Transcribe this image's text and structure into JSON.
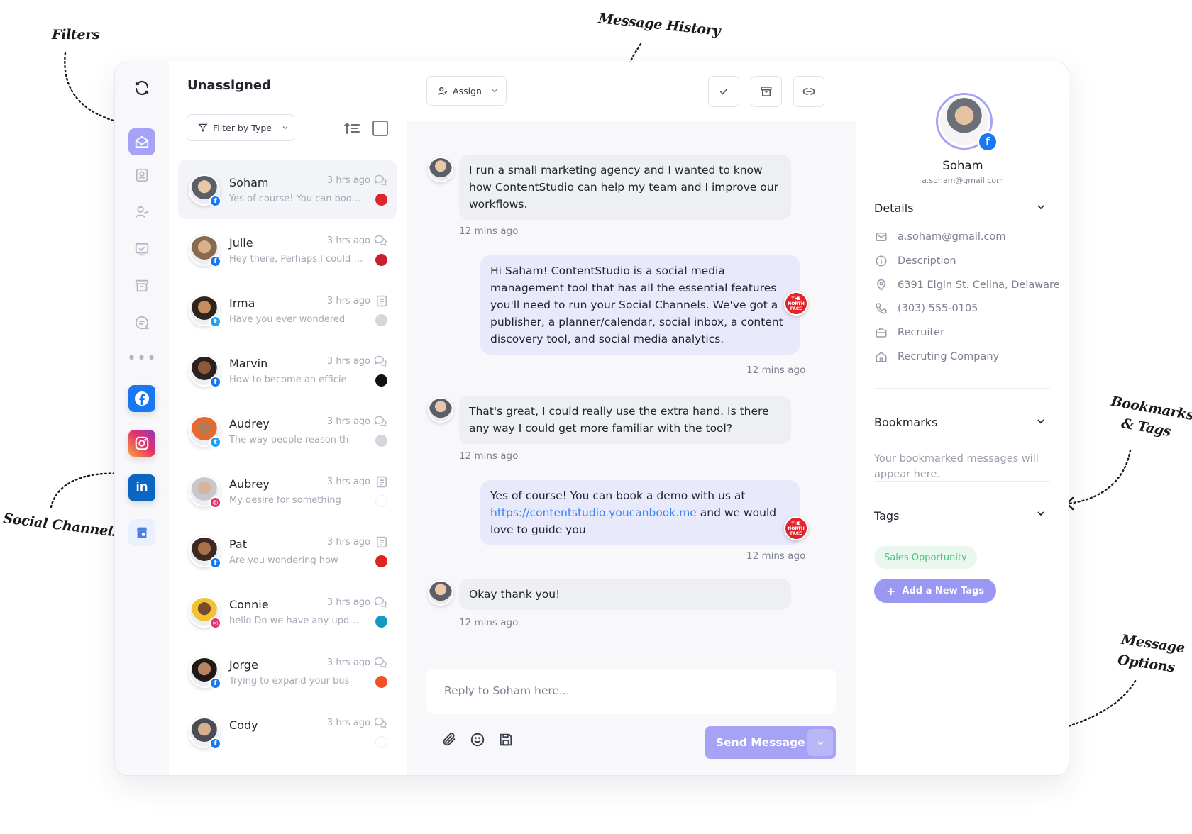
{
  "annotations": {
    "filters": "Filters",
    "message_history": "Message History",
    "social_channels": "Social Channels",
    "bookmarks_tags_line1": "Bookmarks",
    "bookmarks_tags_line2": "& Tags",
    "message_options_line1": "Message",
    "message_options_line2": "Options"
  },
  "list": {
    "title": "Unassigned",
    "filter_label": "Filter by Type",
    "conversations": [
      {
        "name": "Soham",
        "time": "3 hrs ago",
        "preview": "Yes of course! You can book...",
        "channel": "facebook",
        "type_icon": "chat-icon",
        "brand_color": "#e0242c"
      },
      {
        "name": "Julie",
        "time": "3 hrs ago",
        "preview": "Hey there, Perhaps I could i...",
        "channel": "facebook",
        "type_icon": "chat-icon",
        "brand_color": "#c8202f"
      },
      {
        "name": "Irma",
        "time": "3 hrs ago",
        "preview": "Have you ever wondered",
        "channel": "twitter",
        "type_icon": "post-icon",
        "brand_color": "#d5d6db"
      },
      {
        "name": "Marvin",
        "time": "3 hrs ago",
        "preview": "How to become an efficie",
        "channel": "facebook",
        "type_icon": "chat-icon",
        "brand_color": "#111111"
      },
      {
        "name": "Audrey",
        "time": "3 hrs ago",
        "preview": "The way people reason th",
        "channel": "twitter",
        "type_icon": "chat-icon",
        "brand_color": "#d5d6db"
      },
      {
        "name": "Aubrey",
        "time": "3 hrs ago",
        "preview": "My desire for something",
        "channel": "instagram",
        "type_icon": "post-icon",
        "brand_color": "#ffffff"
      },
      {
        "name": "Pat",
        "time": "3 hrs ago",
        "preview": "Are you wondering how",
        "channel": "facebook",
        "type_icon": "post-icon",
        "brand_color": "#da291c"
      },
      {
        "name": "Connie",
        "time": "3 hrs ago",
        "preview": "hello Do we have any update h...",
        "channel": "instagram",
        "type_icon": "chat-icon",
        "brand_color": "#1798c1"
      },
      {
        "name": "Jorge",
        "time": "3 hrs ago",
        "preview": "Trying to expand your bus",
        "channel": "facebook",
        "type_icon": "chat-icon",
        "brand_color": "#f25022"
      },
      {
        "name": "Cody",
        "time": "3 hrs ago",
        "preview": "",
        "channel": "facebook",
        "type_icon": "chat-icon",
        "brand_color": "#ffffff"
      }
    ]
  },
  "chat": {
    "assign_label": "Assign",
    "messages": [
      {
        "dir": "in",
        "text": "I run a small marketing agency and I wanted to know how ContentStudio can help my team and I improve our workflows.",
        "time": "12 mins ago"
      },
      {
        "dir": "out",
        "text": "Hi Saham! ContentStudio is a social media management tool that has all the essential features you'll need to run your Social Channels. We've got a publisher, a planner/calendar, social inbox, a content discovery tool, and social media analytics.",
        "time": "12 mins ago"
      },
      {
        "dir": "in",
        "text": "That's great, I could really use the extra hand. Is there any way I could get more familiar with the tool?",
        "time": "12 mins ago"
      },
      {
        "dir": "out",
        "text_before": "Yes of course! You can book a demo with us at",
        "link": "https://contentstudio.youcanbook.me",
        "text_after": "and we would love to guide you",
        "time": "12 mins ago"
      },
      {
        "dir": "in",
        "text": "Okay thank you!",
        "time": "12 mins ago"
      }
    ],
    "brand_avatar_text": "THE NORTH FACE",
    "reply_placeholder": "Reply to Soham here...",
    "send_label": "Send Message"
  },
  "profile": {
    "name": "Soham",
    "email": "a.soham@gmail.com",
    "details_title": "Details",
    "details": {
      "email": "a.soham@gmail.com",
      "description": "Description",
      "address": "6391 Elgin St. Celina, Delaware",
      "phone": "(303) 555-0105",
      "job": "Recruiter",
      "company": "Recruting Company"
    },
    "bookmarks_title": "Bookmarks",
    "bookmarks_empty": "Your bookmarked messages will appear here.",
    "tags_title": "Tags",
    "tag": "Sales Opportunity",
    "add_tag_label": "Add a New Tags"
  },
  "colors": {
    "accent": "#a6a3f6",
    "tag_green": "#4fbf7f",
    "facebook": "#1877f2",
    "instagram": "#e1306c",
    "linkedin": "#0a66c2",
    "twitter": "#1da1f2"
  }
}
